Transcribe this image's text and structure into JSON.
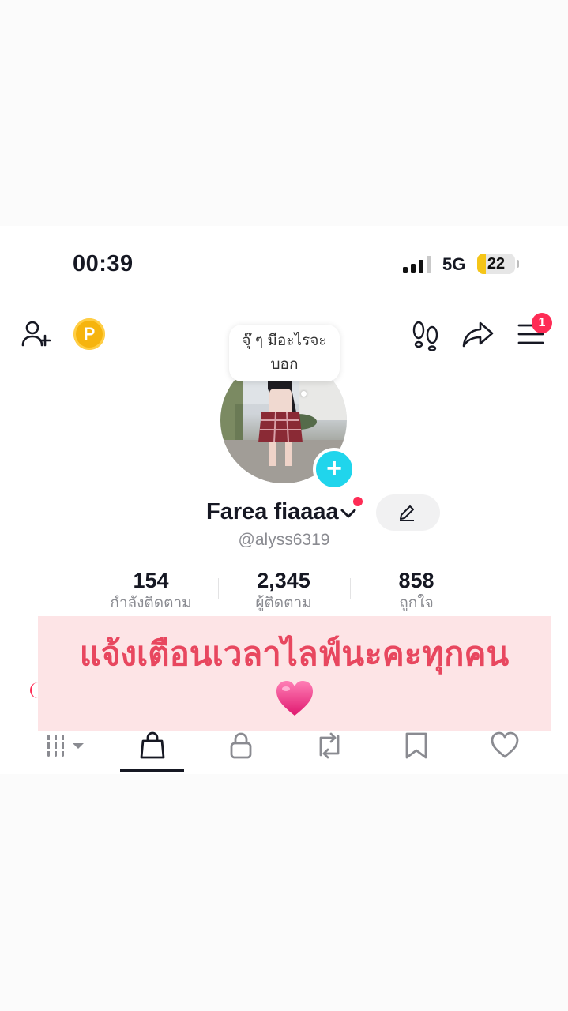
{
  "status_bar": {
    "time": "00:39",
    "network": "5G",
    "battery": "22",
    "battery_level": 0.22
  },
  "top_bar": {
    "coin_letter": "P",
    "menu_badge": "1"
  },
  "bubble": {
    "line1": "จุ๊ ๆ มีอะไรจะ",
    "line2": "บอก"
  },
  "profile": {
    "name": "Farea fiaaaa",
    "handle": "@alyss6319"
  },
  "stats": [
    {
      "value": "154",
      "label": "กำลังติดตาม"
    },
    {
      "value": "2,345",
      "label": "ผู้ติดตาม"
    },
    {
      "value": "858",
      "label": "ถูกใจ"
    }
  ],
  "banner": {
    "text": "แจ้งเตือนเวลาไลฟ์นะคะทุกคน"
  },
  "colors": {
    "accent": "#fe2c55",
    "add_button": "#20d5ec",
    "coin": "#f6b40e",
    "banner_bg": "#fde4e6",
    "banner_text": "#e8475f"
  },
  "tabs": [
    {
      "icon": "grid-icon",
      "active": false
    },
    {
      "icon": "shopping-bag-icon",
      "active": true
    },
    {
      "icon": "lock-icon",
      "active": false
    },
    {
      "icon": "repost-icon",
      "active": false
    },
    {
      "icon": "bookmark-icon",
      "active": false
    },
    {
      "icon": "heart-icon",
      "active": false
    }
  ]
}
